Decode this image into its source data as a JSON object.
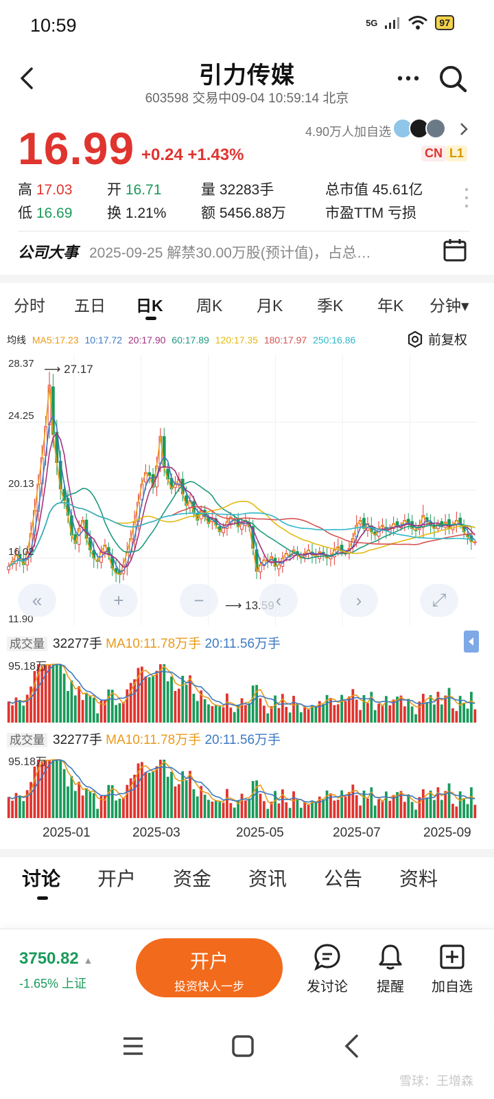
{
  "status": {
    "time": "10:59",
    "network": "5G",
    "battery": "97"
  },
  "header": {
    "title": "引力传媒",
    "subtitle": "603598 交易中09-04 10:59:14 北京"
  },
  "quote": {
    "price": "16.99",
    "change": "+0.24 +1.43%",
    "watchers": "4.90万人加自选",
    "tag_cn": "CN",
    "tag_l1": "L1",
    "stats": {
      "high_label": "高",
      "high": "17.03",
      "low_label": "低",
      "low": "16.69",
      "open_label": "开",
      "open": "16.71",
      "turnover_label": "换",
      "turnover": "1.21%",
      "volume_label": "量",
      "volume": "32283手",
      "amount_label": "额",
      "amount": "5456.88万",
      "mcap_label": "总市值",
      "mcap": "45.61亿",
      "pe_label": "市盈TTM",
      "pe": "亏损"
    }
  },
  "event": {
    "title": "公司大事",
    "text": "2025-09-25 解禁30.00万股(预计值)，占总…"
  },
  "period_tabs": [
    "分时",
    "五日",
    "日K",
    "周K",
    "月K",
    "季K",
    "年K",
    "分钟▾"
  ],
  "active_period": "日K",
  "ma_line": {
    "label": "均线",
    "items": [
      {
        "text": "MA5:17.23",
        "color": "#e99a1a"
      },
      {
        "text": "10:17.72",
        "color": "#3d79c2"
      },
      {
        "text": "20:17.90",
        "color": "#a2307f"
      },
      {
        "text": "60:17.89",
        "color": "#1d9a7f"
      },
      {
        "text": "120:17.35",
        "color": "#e3b910"
      },
      {
        "text": "180:17.97",
        "color": "#d65252"
      },
      {
        "text": "250:16.86",
        "color": "#2fb8c9"
      }
    ],
    "adjust": "前复权"
  },
  "chart_data": {
    "type": "candlestick",
    "y_axis_labels": [
      "28.37",
      "24.25",
      "20.13",
      "16.02",
      "11.90"
    ],
    "ylim": [
      11.9,
      28.37
    ],
    "x_axis_labels": [
      "2025-01",
      "2025-03",
      "2025-05",
      "2025-07",
      "2025-09"
    ],
    "annotations": {
      "high_marker": "27.17",
      "low_marker": "13.59"
    },
    "close_approx": [
      15.5,
      15.8,
      16.2,
      16.0,
      15.6,
      16.4,
      17.5,
      18.9,
      20.5,
      22.1,
      24.0,
      26.5,
      23.5,
      21.8,
      20.2,
      19.5,
      18.6,
      17.4,
      16.9,
      17.8,
      18.3,
      17.2,
      16.5,
      16.0,
      15.8,
      16.4,
      16.8,
      16.2,
      15.4,
      15.1,
      15.0,
      15.6,
      16.4,
      17.2,
      18.2,
      19.4,
      20.5,
      21.2,
      21.0,
      20.3,
      21.6,
      23.4,
      21.5,
      20.8,
      20.2,
      20.5,
      20.8,
      19.9,
      19.2,
      19.5,
      18.8,
      18.3,
      18.9,
      18.5,
      18.1,
      18.4,
      18.0,
      17.6,
      17.9,
      18.2,
      18.5,
      18.3,
      17.9,
      18.1,
      18.3,
      17.9,
      16.6,
      15.2,
      15.6,
      15.9,
      15.8,
      16.1,
      15.5,
      15.6,
      16.0,
      16.3,
      16.1,
      16.5,
      16.2,
      16.0,
      16.3,
      16.5,
      16.2,
      16.1,
      16.4,
      16.2,
      16.0,
      16.1,
      16.5,
      16.7,
      16.4,
      16.3,
      16.6,
      17.2,
      18.0,
      18.3,
      17.8,
      18.1,
      17.6,
      17.4,
      17.8,
      18.0,
      17.7,
      17.8,
      18.1,
      17.9,
      18.0,
      18.3,
      18.1,
      17.8,
      17.7,
      18.0,
      18.6,
      18.2,
      18.0,
      17.8,
      18.1,
      17.9,
      18.2,
      17.8,
      18.0,
      18.3,
      18.1,
      17.6,
      17.3,
      17.0,
      16.99
    ],
    "volume": {
      "label": "成交量",
      "value": "32277手",
      "ma10": "MA10:11.78万手",
      "ma20": "20:11.56万手",
      "max_label": "95.18万"
    }
  },
  "bottom_tabs": [
    "讨论",
    "开户",
    "资金",
    "资讯",
    "公告",
    "资料"
  ],
  "active_bottom_tab": "讨论",
  "footer": {
    "index_value": "3750.82",
    "index_sub": "-1.65% 上证",
    "open_main": "开户",
    "open_sub": "投资快人一步",
    "actions": [
      "发讨论",
      "提醒",
      "加自选"
    ]
  },
  "watermark": "雪球：王增森",
  "colors": {
    "up": "#e0342f",
    "down": "#1a9a5a",
    "accent": "#f26a1b"
  }
}
